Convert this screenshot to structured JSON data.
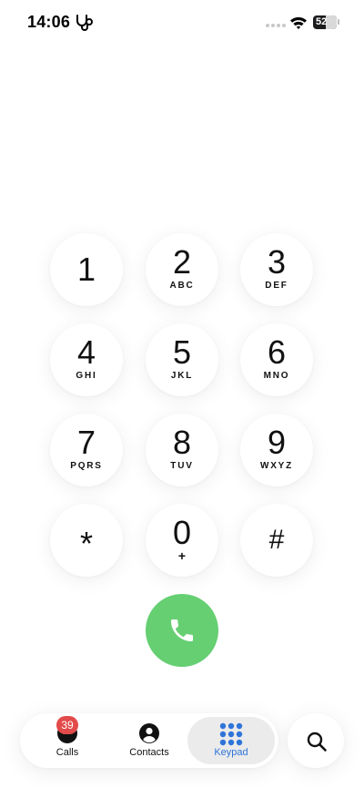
{
  "status_bar": {
    "time": "14:06",
    "battery": "52",
    "left_icon": "stethoscope-icon",
    "wifi_icon": "wifi-icon"
  },
  "keypad": {
    "keys": [
      {
        "digit": "1",
        "letters": ""
      },
      {
        "digit": "2",
        "letters": "ABC"
      },
      {
        "digit": "3",
        "letters": "DEF"
      },
      {
        "digit": "4",
        "letters": "GHI"
      },
      {
        "digit": "5",
        "letters": "JKL"
      },
      {
        "digit": "6",
        "letters": "MNO"
      },
      {
        "digit": "7",
        "letters": "PQRS"
      },
      {
        "digit": "8",
        "letters": "TUV"
      },
      {
        "digit": "9",
        "letters": "WXYZ"
      },
      {
        "digit": "*",
        "letters": ""
      },
      {
        "digit": "0",
        "letters": "+"
      },
      {
        "digit": "#",
        "letters": ""
      }
    ],
    "call_color": "#65cf72"
  },
  "tabbar": {
    "calls_label": "Calls",
    "calls_badge": "39",
    "contacts_label": "Contacts",
    "keypad_label": "Keypad",
    "active_tab": "Keypad",
    "accent": "#2f74d8",
    "badge_color": "#e34a4a"
  }
}
